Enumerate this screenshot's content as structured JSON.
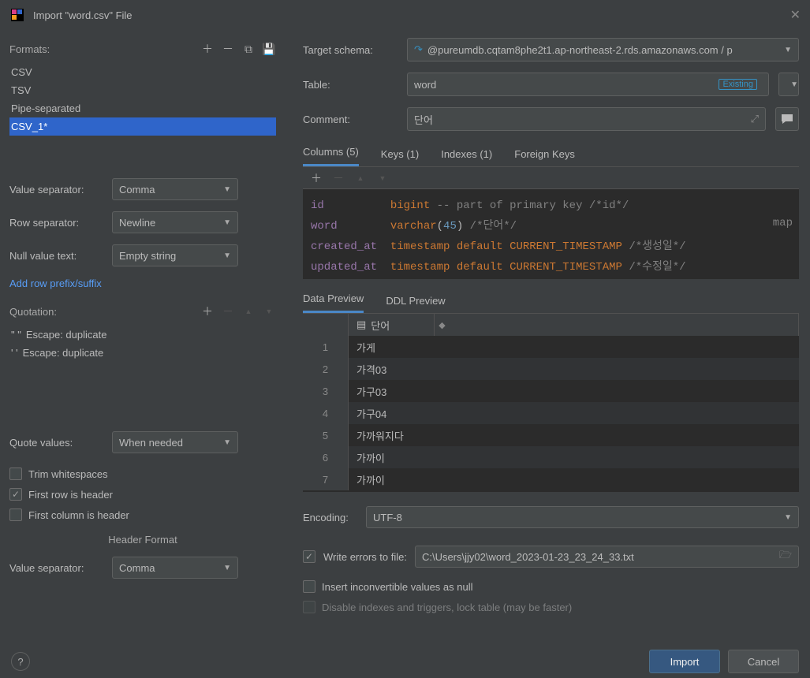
{
  "title": "Import \"word.csv\" File",
  "formats": {
    "label": "Formats:",
    "items": [
      "CSV",
      "TSV",
      "Pipe-separated",
      "CSV_1*"
    ],
    "selected": 3
  },
  "valueSeparator": {
    "label": "Value separator:",
    "value": "Comma"
  },
  "rowSeparator": {
    "label": "Row separator:",
    "value": "Newline"
  },
  "nullValueText": {
    "label": "Null value text:",
    "value": "Empty string"
  },
  "addRowLink": "Add row prefix/suffix",
  "quotation": {
    "label": "Quotation:",
    "rows": [
      {
        "quote": "\"  \"",
        "escape": "Escape: duplicate"
      },
      {
        "quote": "'  '",
        "escape": "Escape: duplicate"
      }
    ]
  },
  "quoteValues": {
    "label": "Quote values:",
    "value": "When needed"
  },
  "checks": {
    "trim": {
      "label": "Trim whitespaces",
      "checked": false
    },
    "firstRowHeader": {
      "label": "First row is header",
      "checked": true
    },
    "firstColHeader": {
      "label": "First column is header",
      "checked": false
    }
  },
  "headerFormat": "Header Format",
  "valueSeparator2": {
    "label": "Value separator:",
    "value": "Comma"
  },
  "right": {
    "targetSchema": {
      "label": "Target schema:",
      "value": "@pureumdb.cqtam8phe2t1.ap-northeast-2.rds.amazonaws.com / p"
    },
    "table": {
      "label": "Table:",
      "value": "word",
      "badge": "Existing"
    },
    "comment": {
      "label": "Comment:",
      "value": "단어"
    },
    "tabs": [
      "Columns (5)",
      "Keys (1)",
      "Indexes (1)",
      "Foreign Keys"
    ],
    "columns": [
      {
        "name": "id",
        "type": "bigint",
        "comment": "-- part of primary key /*id*/"
      },
      {
        "name": "word",
        "type": "varchar",
        "arg": "45",
        "comment": "/*단어*/"
      },
      {
        "name": "created_at",
        "type": "timestamp default CURRENT_TIMESTAMP",
        "comment": "/*생성일*/"
      },
      {
        "name": "updated_at",
        "type": "timestamp default CURRENT_TIMESTAMP",
        "comment": "/*수정일*/"
      }
    ],
    "minimap": "map",
    "tabs2": [
      "Data Preview",
      "DDL Preview"
    ],
    "dataHeader": "단어",
    "dataRows": [
      "가게",
      "가격03",
      "가구03",
      "가구04",
      "가까워지다",
      "가까이",
      "가까이"
    ],
    "encoding": {
      "label": "Encoding:",
      "value": "UTF-8"
    },
    "writeErrors": {
      "label": "Write errors to file:",
      "checked": true,
      "value": "C:\\Users\\jjy02\\word_2023-01-23_23_24_33.txt"
    },
    "insertNull": {
      "label": "Insert inconvertible values as null",
      "checked": false
    },
    "disableIndexes": {
      "label": "Disable indexes and triggers, lock table (may be faster)",
      "checked": false,
      "disabled": true
    }
  },
  "buttons": {
    "import": "Import",
    "cancel": "Cancel"
  }
}
